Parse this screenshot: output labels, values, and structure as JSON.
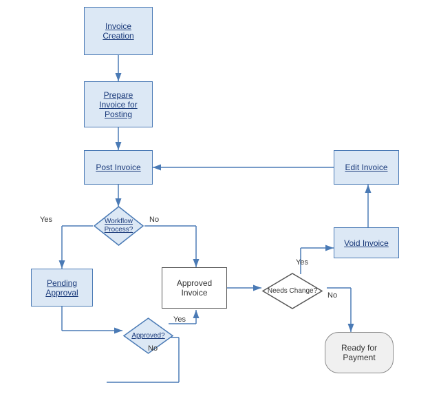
{
  "nodes": {
    "invoice_creation": {
      "label": "Invoice\nCreation"
    },
    "prepare_invoice": {
      "label": "Prepare\nInvoice for\nPosting"
    },
    "post_invoice": {
      "label": "Post Invoice"
    },
    "workflow_process": {
      "label": "Workflow\nProcess?"
    },
    "pending_approval": {
      "label": "Pending\nApproval"
    },
    "approved_diamond": {
      "label": "Approved?"
    },
    "approved_invoice": {
      "label": "Approved\nInvoice"
    },
    "needs_change": {
      "label": "Needs\nChange?"
    },
    "void_invoice": {
      "label": "Void Invoice"
    },
    "edit_invoice": {
      "label": "Edit Invoice"
    },
    "ready_for_payment": {
      "label": "Ready for\nPayment"
    }
  },
  "labels": {
    "yes1": "Yes",
    "no1": "No",
    "yes2": "Yes",
    "no2": "No",
    "yes3": "Yes",
    "no3": "No"
  },
  "colors": {
    "box_bg": "#dce8f5",
    "box_border": "#4a7ab5",
    "arrow": "#4a7ab5",
    "text": "#1a3a7a"
  }
}
